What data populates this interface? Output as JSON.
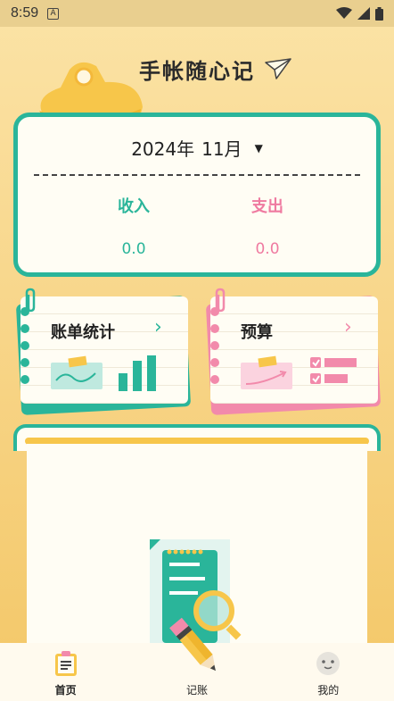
{
  "status_bar": {
    "time": "8:59",
    "notification_letter": "A"
  },
  "app": {
    "title": "手帐随心记"
  },
  "summary": {
    "year": "2024年",
    "month": "11月",
    "income_label": "收入",
    "income_value": "0.0",
    "expense_label": "支出",
    "expense_value": "0.0"
  },
  "cards": {
    "bills_title": "账单统计",
    "budget_title": "预算",
    "arrow": "›"
  },
  "nav": {
    "home": "首页",
    "record": "记账",
    "me": "我的"
  },
  "colors": {
    "green": "#2ab59a",
    "pink": "#f28aab",
    "yellow": "#f7c64a"
  }
}
